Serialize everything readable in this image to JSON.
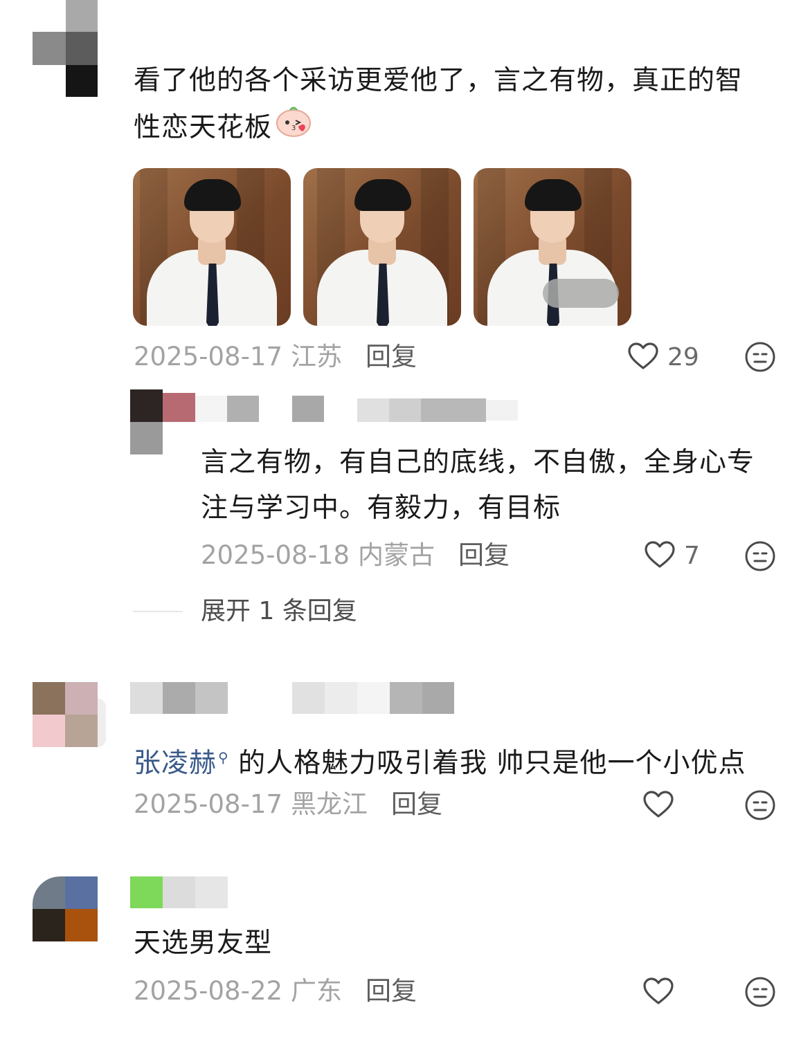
{
  "comments": [
    {
      "text_line1": "看了他的各个采访更爱他了，言之有物，真正的智",
      "text_line2": "性恋天花板",
      "date": "2025-08-17",
      "location": "江苏",
      "reply_label": "回复",
      "like_count": "29",
      "images": [
        "thumbnail-1",
        "thumbnail-2",
        "thumbnail-3"
      ],
      "reply": {
        "text_line1": "言之有物，有自己的底线，不自傲，全身心专",
        "text_line2": "注与学习中。有毅力，有目标",
        "date": "2025-08-18",
        "location": "内蒙古",
        "reply_label": "回复",
        "like_count": "7"
      },
      "expand_label": "展开 1 条回复"
    },
    {
      "mention": "张凌赫",
      "text": " 的人格魅力吸引着我 帅只是他一个小优点",
      "date": "2025-08-17",
      "location": "黑龙江",
      "reply_label": "回复",
      "like_count": ""
    },
    {
      "text": "天选男友型",
      "date": "2025-08-22",
      "location": "广东",
      "reply_label": "回复",
      "like_count": ""
    }
  ],
  "colors": {
    "meta_text": "#a3a3a3",
    "reply_text": "#5d5d5d",
    "mention": "#3a5a8a",
    "icon_stroke": "#4a4a4a"
  },
  "icons": [
    "heart-outline-icon",
    "meh-face-icon",
    "search-icon",
    "emoji-sticker-icon"
  ]
}
